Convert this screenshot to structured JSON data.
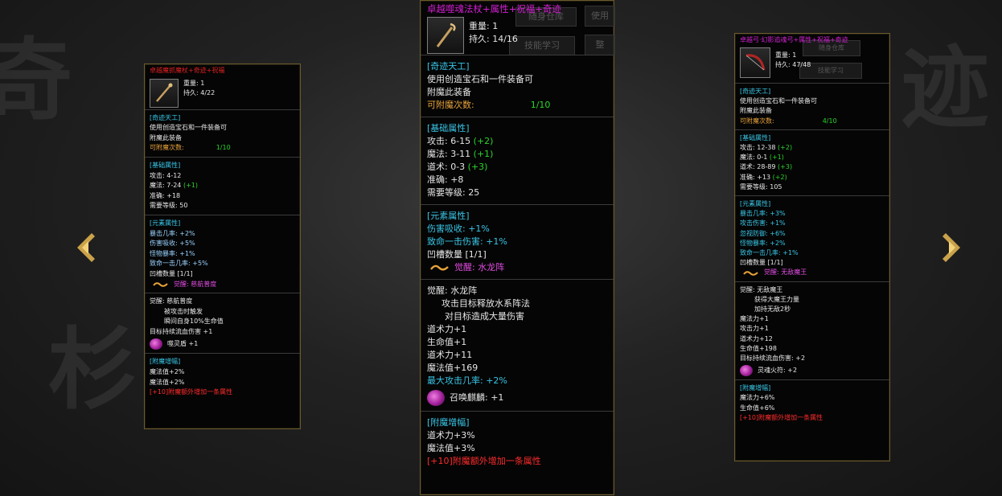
{
  "navigation": {
    "prev_icon": "chevron-left-icon",
    "next_icon": "chevron-right-icon"
  },
  "left": {
    "title": "卓越魔抓魔杖+奇迹+祝福",
    "weight_label": "重量:",
    "weight": "1",
    "durability_label": "持久:",
    "durability": "4/22",
    "miracle": {
      "header": "[奇迹天工]",
      "line1": "使用创造宝石和一件装备可",
      "line2": "附魔此装备",
      "count_label": "可附魔次数:",
      "count": "1/10"
    },
    "base": {
      "header": "[基础属性]",
      "attack": "攻击: 4-12",
      "magic": "魔法: 7-24",
      "magic_bonus": "(+1)",
      "accuracy": "准确: +18",
      "level": "需要等级: 50"
    },
    "element": {
      "header": "[元素属性]",
      "s1": "暴击几率: +2%",
      "s2": "伤害吸收: +5%",
      "s3": "怪物暴率: +1%",
      "s4": "致命一击几率: +5%",
      "slots": "凹槽数量 [1/1]",
      "awaken": "觉醒: 慈航普度"
    },
    "awaken_detail": {
      "name": "觉醒: 慈航普度",
      "l1": "被攻击时触发",
      "l2": "瞬间自身10%生命值",
      "l3": "目标持续流血伤害 +1",
      "gem_text": "噬灵盾 +1"
    },
    "enchant": {
      "header": "[附魔增幅]",
      "l1": "魔法值+2%",
      "l2": "魔法值+2%",
      "note": "[+10]附魔额外增加一条属性"
    }
  },
  "center": {
    "title": "卓越噬魂法杖+属性+祝福+奇迹",
    "weight_label": "重量:",
    "weight": "1",
    "durability_label": "持久:",
    "durability": "14/16",
    "ghost1": "随身仓库",
    "ghost2": "使用",
    "ghost3": "技能学习",
    "ghost4": "整",
    "miracle": {
      "header": "[奇迹天工]",
      "line1": "使用创造宝石和一件装备可",
      "line2": "附魔此装备",
      "count_label": "可附魔次数:",
      "count": "1/10"
    },
    "base": {
      "header": "[基础属性]",
      "attack": "攻击: 6-15",
      "attack_bonus": "(+2)",
      "magic": "魔法: 3-11",
      "magic_bonus": "(+1)",
      "tao": "道术: 0-3",
      "tao_bonus": "(+3)",
      "accuracy": "准确: +8",
      "level": "需要等级: 25"
    },
    "element": {
      "header": "[元素属性]",
      "s1": "伤害吸收: +1%",
      "s2": "致命一击伤害: +1%",
      "slots": "凹槽数量 [1/1]",
      "awaken": "觉醒: 水龙阵"
    },
    "awaken_detail": {
      "name": "觉醒: 水龙阵",
      "l1": "攻击目标释放水系阵法",
      "l2": "对目标造成大量伤害",
      "l3": "道术力+1",
      "l4": "生命值+1",
      "l5": "道术力+11",
      "l6": "魔法值+169",
      "l7": "最大攻击几率: +2%",
      "gem_text": "召唤麒麟: +1"
    },
    "enchant": {
      "header": "[附魔增幅]",
      "l1": "道术力+3%",
      "l2": "魔法值+3%",
      "note": "[+10]附魔额外增加一条属性"
    }
  },
  "right": {
    "title": "卓越弓·幻影追魂弓+属性+祝福+奇迹",
    "weight_label": "重量:",
    "weight": "1",
    "durability_label": "持久:",
    "durability": "47/48",
    "ghost1": "随身仓库",
    "ghost2": "技能学习",
    "miracle": {
      "header": "[奇迹天工]",
      "line1": "使用创造宝石和一件装备可",
      "line2": "附魔此装备",
      "count_label": "可附魔次数:",
      "count": "4/10"
    },
    "base": {
      "header": "[基础属性]",
      "attack": "攻击: 12-38",
      "attack_bonus": "(+2)",
      "magic": "魔法: 0-1",
      "magic_bonus": "(+1)",
      "tao": "道术: 28-89",
      "tao_bonus": "(+3)",
      "accuracy": "准确: +13",
      "accuracy_bonus": "(+2)",
      "level": "需要等级: 105"
    },
    "element": {
      "header": "[元素属性]",
      "s1": "暴击几率: +3%",
      "s2": "攻击伤害: +1%",
      "s3": "忽视防御: +6%",
      "s4": "怪物暴率: +2%",
      "s5": "致命一击几率: +1%",
      "slots": "凹槽数量 [1/1]",
      "awaken": "觉醒: 无敌魔王"
    },
    "awaken_detail": {
      "name": "觉醒: 无敌魔王",
      "l1": "获得大魔王力量",
      "l2": "加持无敌2秒",
      "l3": "魔法力+1",
      "l4": "攻击力+1",
      "l5": "道术力+12",
      "l6": "生命值+198",
      "l7": "目标持续流血伤害: +2",
      "gem_text": "灵魂火符: +2"
    },
    "enchant": {
      "header": "[附魔增幅]",
      "l1": "魔法力+6%",
      "l2": "生命值+6%",
      "note": "[+10]附魔额外增加一条属性"
    }
  },
  "colors": {
    "title": "#d31ed3",
    "header": "#39c6e6",
    "bonus": "#2ad52a",
    "count_label": "#e8a23a",
    "note": "#ff2b2b",
    "border": "#6b5a2c"
  }
}
